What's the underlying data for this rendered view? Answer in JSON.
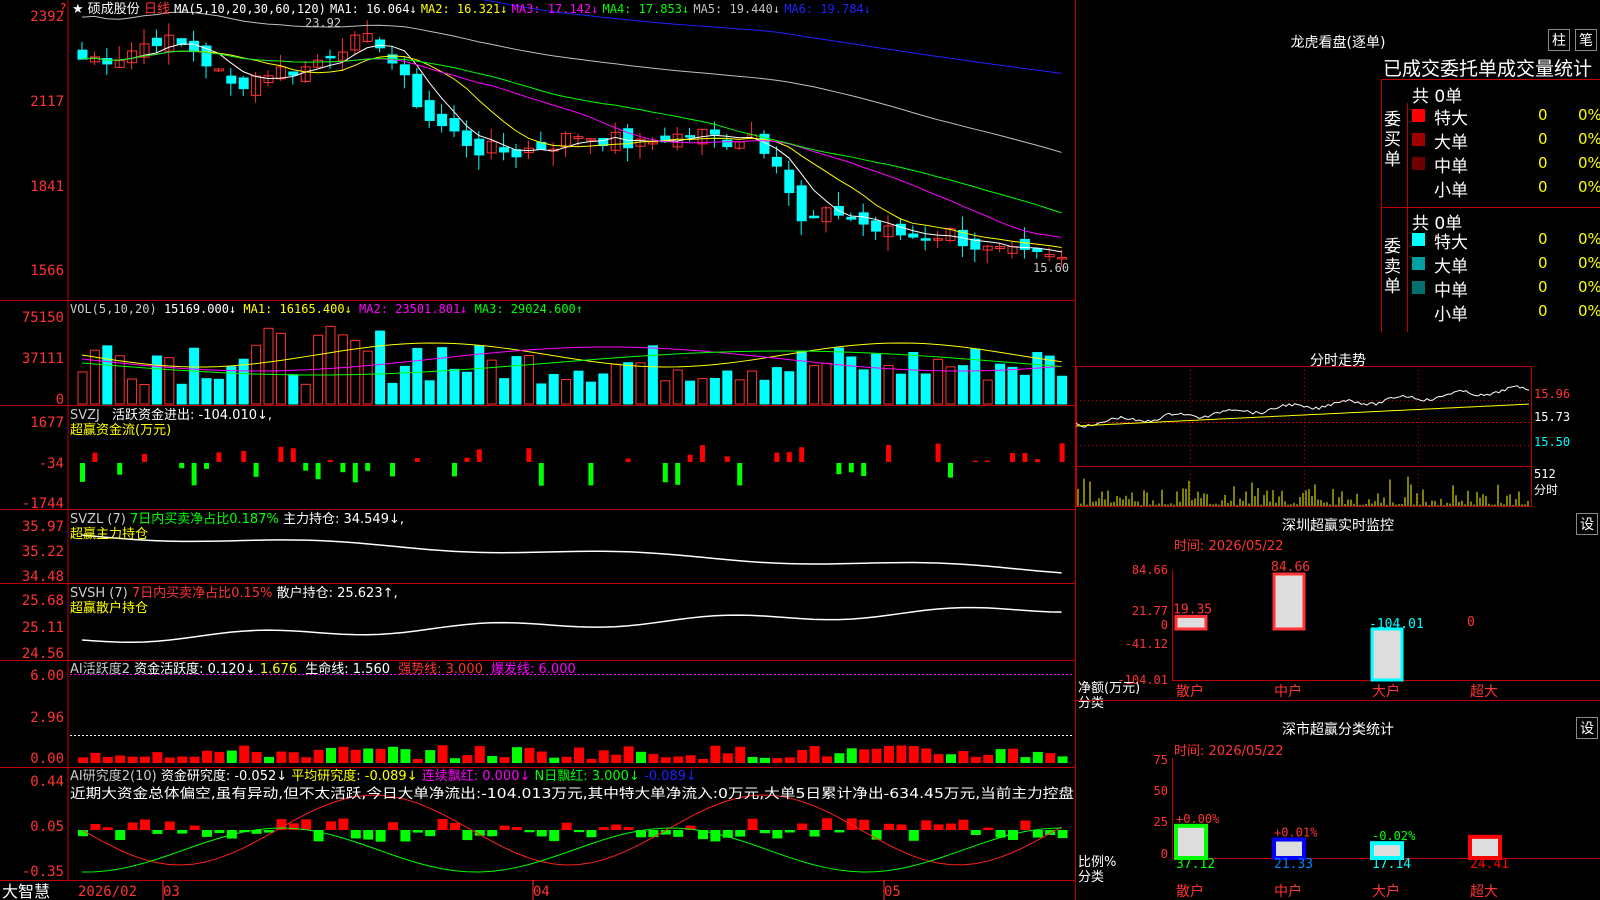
{
  "footer": {
    "logo": "大智慧",
    "dates": [
      "2026/02",
      "03",
      "04",
      "05"
    ]
  },
  "main_chart": {
    "header": {
      "star": "★",
      "stock_name": "硕成股份",
      "period": "日线",
      "ma_params": "MA(5,10,20,30,60,120)",
      "ma1": "MA1: 16.064↓",
      "ma2": "MA2: 16.321↓",
      "ma3": "MA3: 17.142↓",
      "ma4": "MA4: 17.853↓",
      "ma5": "MA5: 19.440↓",
      "ma6": "MA6: 19.784↓"
    },
    "corner_marker": "?",
    "high_label": "23.92",
    "low_label": "15.60",
    "yaxis": [
      "2392",
      "2117",
      "1841",
      "1566"
    ],
    "colors": {
      "up": "#ff3333",
      "down": "#00ffff",
      "ma1": "#ffffff",
      "ma2": "#ffff00",
      "ma3": "#ff00ff",
      "ma4": "#00ff00",
      "ma5": "#c0c0c0",
      "ma6": "#2020ff"
    }
  },
  "volume_panel": {
    "header": {
      "params": "VOL(5,10,20)",
      "value": "15169.000↓",
      "ma1": "MA1: 16165.400↓",
      "ma2": "MA2: 23501.801↓",
      "ma3": "MA3: 29024.600↑"
    },
    "yaxis": [
      "75150",
      "37111",
      "0"
    ]
  },
  "svzj_panel": {
    "header": {
      "name": "SVZJ",
      "label": "活跃资金进出: -104.010↓,",
      "sub": "超赢资金流(万元)"
    },
    "yaxis": [
      "1677",
      "-34",
      "-1744"
    ]
  },
  "svzl_panel": {
    "header": {
      "name": "SVZL (7)",
      "ratio": "7日内买卖净占比0.187%",
      "holding": "主力持仓: 34.549↓,",
      "sub": "超赢主力持仓"
    },
    "yaxis": [
      "35.97",
      "35.22",
      "34.48"
    ]
  },
  "svsh_panel": {
    "header": {
      "name": "SVSH (7)",
      "ratio": "7日内买卖净占比0.15%",
      "holding": "散户持仓: 25.623↑,",
      "sub": "超赢散户持仓"
    },
    "yaxis": [
      "25.68",
      "25.11",
      "24.56"
    ]
  },
  "ai_active_panel": {
    "header": {
      "name": "AI活跃度2",
      "active": "资金活跃度: 0.120↓",
      "v2": "1.676",
      "life": "生命线: 1.560",
      "strong": "强势线: 3.000",
      "burst": "爆发线: 6.000"
    },
    "yaxis": [
      "6.00",
      "2.96",
      "0.00"
    ]
  },
  "ai_research_panel": {
    "header": {
      "name": "AI研究度2(10)",
      "research": "资金研究度: -0.052↓",
      "avg": "平均研究度: -0.089↓",
      "red": "连续飘红: 0.000↓",
      "nday": "N日飘红: 3.000↓",
      "last": "-0.089↓"
    },
    "scroll_text": "近期大资金总体偏空,虽有异动,但不太活跃,今日大单净流出:-104.013万元,其中特大单净流入:0万元,大单5日累计净出-634.45万元,当前主力控盘",
    "yaxis": [
      "0.44",
      "0.05",
      "-0.35"
    ]
  },
  "right_top": {
    "title": "龙虎看盘(逐单)",
    "btn_zhu": "柱",
    "btn_bi": "笔",
    "tabs_text": "已成交委托单成交量统计",
    "buy": {
      "side_label": "委买单",
      "total": "共 0单",
      "rows": [
        {
          "label": "特大",
          "count": "0",
          "pct": "0%",
          "color": "#ff0000"
        },
        {
          "label": "大单",
          "count": "0",
          "pct": "0%",
          "color": "#a00000"
        },
        {
          "label": "中单",
          "count": "0",
          "pct": "0%",
          "color": "#700000"
        },
        {
          "label": "小单",
          "count": "0",
          "pct": "0%",
          "color": ""
        }
      ]
    },
    "sell": {
      "side_label": "委卖单",
      "total": "共 0单",
      "rows": [
        {
          "label": "特大",
          "count": "0",
          "pct": "0%",
          "color": "#00ffff"
        },
        {
          "label": "大单",
          "count": "0",
          "pct": "0%",
          "color": "#00a0a0"
        },
        {
          "label": "中单",
          "count": "0",
          "pct": "0%",
          "color": "#007070"
        },
        {
          "label": "小单",
          "count": "0",
          "pct": "0%",
          "color": ""
        }
      ]
    }
  },
  "intraday": {
    "title": "分时走势",
    "yaxis": [
      "15.96",
      "15.73",
      "15.50"
    ],
    "vol_label": "512",
    "vol_unit": "分时"
  },
  "sz_monitor": {
    "title": "深圳超赢实时监控",
    "gear": "设",
    "time": "时间: 2026/05/22",
    "yaxis": [
      "84.66",
      "21.77",
      "0",
      "-41.12",
      "-104.01"
    ],
    "unit": "净额(万元)",
    "cat_label": "分类",
    "chart_data": {
      "type": "bar",
      "categories": [
        "散户",
        "中户",
        "大户",
        "超大"
      ],
      "values": [
        19.35,
        84.66,
        -104.01,
        0
      ],
      "value_labels": [
        "19.35",
        "84.66",
        "-104.01",
        "0"
      ]
    }
  },
  "sz_classify": {
    "title": "深市超赢分类统计",
    "gear": "设",
    "time": "时间: 2026/05/22",
    "yaxis": [
      "75",
      "50",
      "25",
      "0"
    ],
    "unit": "比例%",
    "cat_label": "分类",
    "chart_data": {
      "type": "bar",
      "categories": [
        "散户",
        "中户",
        "大户",
        "超大"
      ],
      "values": [
        37.12,
        21.33,
        17.14,
        24.41
      ],
      "change_labels": [
        "+0.00%",
        "+0.01%",
        "-0.02%",
        ""
      ],
      "value_labels": [
        "37.12",
        "21.33",
        "17.14",
        "24.41"
      ]
    }
  }
}
